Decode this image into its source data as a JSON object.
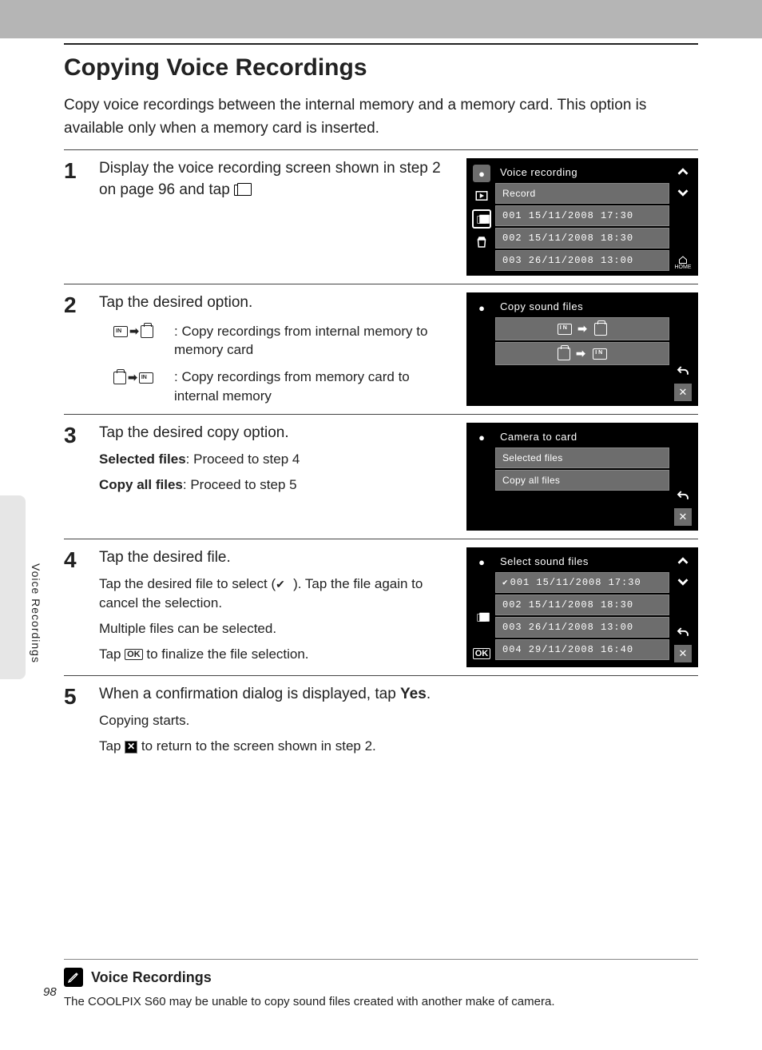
{
  "page_number": "98",
  "sidebar_label": "Voice Recordings",
  "title": "Copying Voice Recordings",
  "intro": "Copy voice recordings between the internal memory and a memory card. This option is available only when a memory card is inserted.",
  "steps": {
    "s1": {
      "num": "1",
      "text_a": "Display the voice recording screen shown in step 2 on page 96 and tap ",
      "text_b": "."
    },
    "s2": {
      "num": "2",
      "text": "Tap the desired option.",
      "def1": ": Copy recordings from internal memory to memory card",
      "def2": ":  Copy recordings from memory card to internal memory"
    },
    "s3": {
      "num": "3",
      "text": "Tap the desired copy option.",
      "sub1a": "Selected files",
      "sub1b": ": Proceed to step 4",
      "sub2a": "Copy all files",
      "sub2b": ": Proceed to step 5"
    },
    "s4": {
      "num": "4",
      "text": "Tap the desired file.",
      "sub1a": "Tap the desired file to select (",
      "sub1b": "). Tap the file again to cancel the selection.",
      "sub2": "Multiple files can be selected.",
      "sub3a": "Tap ",
      "sub3b": " to finalize the file selection."
    },
    "s5": {
      "num": "5",
      "text_a": "When a confirmation dialog is displayed, tap ",
      "text_b": "Yes",
      "text_c": ".",
      "sub1": "Copying starts.",
      "sub2a": "Tap ",
      "sub2b": " to return to the screen shown in step 2."
    }
  },
  "screens": {
    "s1": {
      "title": "Voice recording",
      "record": "Record",
      "rows": [
        "001  15/11/2008  17:30",
        "002  15/11/2008  18:30",
        "003  26/11/2008  13:00"
      ],
      "home": "HOME"
    },
    "s2": {
      "title": "Copy sound files"
    },
    "s3": {
      "title": "Camera to card",
      "rows": [
        "Selected files",
        "Copy all files"
      ]
    },
    "s4": {
      "title": "Select sound files",
      "rows": [
        "001  15/11/2008  17:30",
        "002  15/11/2008  18:30",
        "003  26/11/2008  13:00",
        "004  29/11/2008  16:40"
      ]
    }
  },
  "note": {
    "heading": "Voice Recordings",
    "body": "The COOLPIX S60 may be unable to copy sound files created with another make of camera."
  }
}
